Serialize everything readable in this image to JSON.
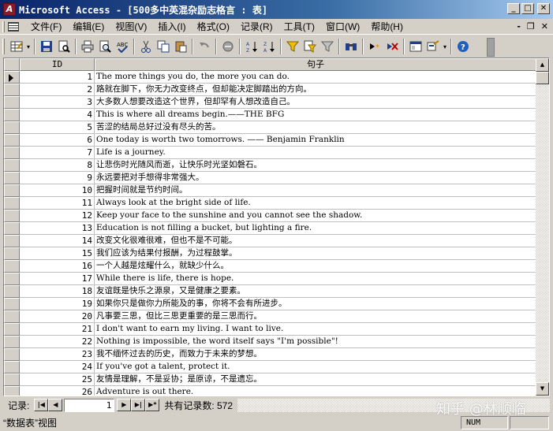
{
  "window": {
    "title": "Microsoft Access - [500多中英混杂励志格言 : 表]",
    "min_label": "_",
    "max_label": "□",
    "close_label": "✕"
  },
  "menu": [
    "文件(F)",
    "编辑(E)",
    "视图(V)",
    "插入(I)",
    "格式(O)",
    "记录(R)",
    "工具(T)",
    "窗口(W)",
    "帮助(H)"
  ],
  "doc_controls": {
    "min": "-",
    "restore": "❐",
    "close": "✕"
  },
  "toolbar_icons": [
    "datasheet-view-icon",
    "save-icon",
    "print-icon",
    "print-preview-icon",
    "spelling-icon",
    "cut-icon",
    "copy-icon",
    "paste-icon",
    "undo-icon",
    "hyperlink-icon",
    "sort-ascending-icon",
    "sort-descending-icon",
    "filter-by-selection-icon",
    "filter-by-form-icon",
    "apply-filter-icon",
    "find-icon",
    "new-record-icon",
    "delete-record-icon",
    "database-window-icon",
    "new-object-icon",
    "help-icon"
  ],
  "grid": {
    "columns": [
      "ID",
      "句子"
    ],
    "current_row_index": 0,
    "rows": [
      {
        "id": "1",
        "text": "The more things you do, the more you can do."
      },
      {
        "id": "2",
        "text": "路就在脚下，你无力改变终点，但却能决定脚踏出的方向。"
      },
      {
        "id": "3",
        "text": "大多数人想要改造这个世界，但却罕有人想改造自己。"
      },
      {
        "id": "4",
        "text": "This is where all dreams begin.——THE BFG"
      },
      {
        "id": "5",
        "text": "苦涩的结局总好过没有尽头的苦。"
      },
      {
        "id": "6",
        "text": "One today is worth two tomorrows. —— Benjamin Franklin"
      },
      {
        "id": "7",
        "text": "Life is a journey."
      },
      {
        "id": "8",
        "text": "让悲伤时光随风而逝，让快乐时光坚如磐石。"
      },
      {
        "id": "9",
        "text": "永远要把对手想得非常强大。"
      },
      {
        "id": "10",
        "text": "把握时间就是节约时间。"
      },
      {
        "id": "11",
        "text": "Always look at the bright side of life."
      },
      {
        "id": "12",
        "text": "Keep your face to the sunshine and you cannot see the shadow."
      },
      {
        "id": "13",
        "text": "Education is not filling a bucket, but lighting a fire."
      },
      {
        "id": "14",
        "text": "改变文化很难很难，但也不是不可能。"
      },
      {
        "id": "15",
        "text": "我们应该为结果付报酬，为过程鼓掌。"
      },
      {
        "id": "16",
        "text": "一个人越是炫耀什么，就缺少什么。"
      },
      {
        "id": "17",
        "text": "While there is life, there is hope."
      },
      {
        "id": "18",
        "text": "友谊既是快乐之源泉，又是健康之要素。"
      },
      {
        "id": "19",
        "text": "如果你只是做你力所能及的事，你将不会有所进步。"
      },
      {
        "id": "20",
        "text": "凡事要三思，但比三思更重要的是三思而行。"
      },
      {
        "id": "21",
        "text": "I don't want to earn my living. I want to live."
      },
      {
        "id": "22",
        "text": "Nothing is impossible, the word itself says \"I'm possible\"!"
      },
      {
        "id": "23",
        "text": "我不缅怀过去的历史，而致力于未来的梦想。"
      },
      {
        "id": "24",
        "text": "If you've got a talent, protect it."
      },
      {
        "id": "25",
        "text": "友情是理解，不是妥协；是原谅，不是遗忘。"
      },
      {
        "id": "26",
        "text": "Adventure is out there."
      }
    ]
  },
  "record_nav": {
    "label": "记录:",
    "first": "|◀",
    "prev": "◀",
    "current": "1",
    "next": "▶",
    "last": "▶|",
    "new": "▶*",
    "total_label": "共有记录数: 572"
  },
  "status": {
    "view": "“数据表”视图",
    "num": "NUM"
  },
  "watermark": "知乎 @林顺临"
}
